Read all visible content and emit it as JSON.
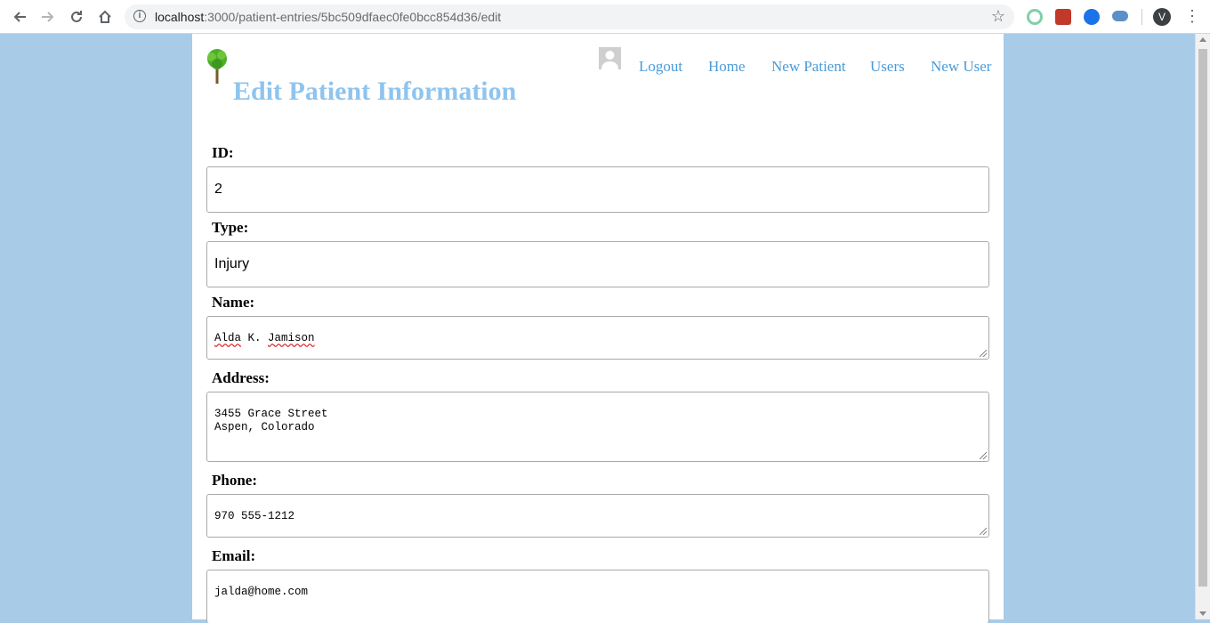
{
  "browser": {
    "url_host": "localhost",
    "url_path": ":3000/patient-entries/5bc509dfaec0fe0bcc854d36/edit",
    "profile_initial": "V",
    "icons": {
      "back": "back-arrow-icon",
      "forward": "forward-arrow-icon",
      "reload": "reload-icon",
      "home": "home-icon",
      "info": "info-icon",
      "bookmark": "star-icon",
      "menu": "menu-dots-icon"
    },
    "extensions": [
      "extension-green-icon",
      "extension-red-icon",
      "extension-blue-icon",
      "extension-cloud-icon"
    ]
  },
  "header": {
    "title": "Edit Patient Information",
    "nav": {
      "logout": "Logout",
      "home": "Home",
      "new_patient": "New Patient",
      "users": "Users",
      "new_user": "New User"
    },
    "title_color": "#8ec4ee",
    "link_color": "#4a9bd8"
  },
  "form": {
    "id_label": "ID:",
    "id_value": "2",
    "type_label": "Type:",
    "type_value": "Injury",
    "name_label": "Name:",
    "name_first": "Alda",
    "name_middle": " K. ",
    "name_last": "Jamison",
    "address_label": "Address:",
    "address_value": "3455 Grace Street\nAspen, Colorado",
    "phone_label": "Phone:",
    "phone_value": "970 555-1212",
    "email_label": "Email:",
    "email_value": "jalda@home.com"
  },
  "colors": {
    "page_background": "#a8cbe8",
    "content_background": "#ffffff"
  }
}
